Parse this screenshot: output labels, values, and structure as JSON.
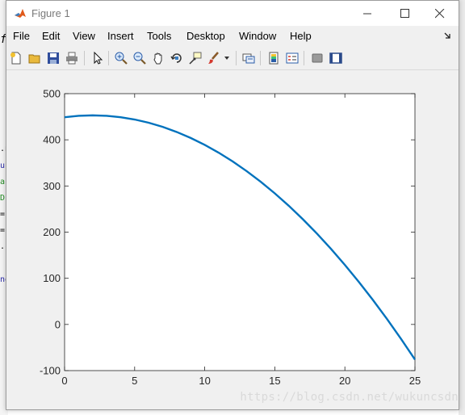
{
  "window": {
    "title": "Figure 1",
    "controls": {
      "minimize": "—",
      "maximize": "☐",
      "close": "✕"
    }
  },
  "menu": {
    "items": [
      "File",
      "Edit",
      "View",
      "Insert",
      "Tools",
      "Desktop",
      "Window",
      "Help"
    ]
  },
  "toolbar": {
    "buttons": [
      "new-figure-icon",
      "open-file-icon",
      "save-icon",
      "print-icon",
      "select-arrow-icon",
      "zoom-in-icon",
      "zoom-out-icon",
      "pan-hand-icon",
      "rotate-3d-icon",
      "data-cursor-icon",
      "brush-icon",
      "link-plot-icon",
      "colorbar-icon",
      "legend-icon",
      "hide-plot-tools-icon",
      "show-plot-tools-icon"
    ]
  },
  "background_fragments": [
    "f",
    ".n",
    "ur",
    "a",
    "D",
    "=",
    "=",
    ".c",
    "nd"
  ],
  "chart_data": {
    "type": "line",
    "xlim": [
      0,
      25
    ],
    "ylim": [
      -100,
      500
    ],
    "x_ticks": [
      "0",
      "5",
      "10",
      "15",
      "20",
      "25"
    ],
    "y_ticks": [
      "-100",
      "0",
      "100",
      "200",
      "300",
      "400",
      "500"
    ],
    "series": [
      {
        "color": "#0072bd",
        "x": [
          0,
          1,
          2,
          3,
          4,
          5,
          6,
          7,
          8,
          9,
          10,
          11,
          12,
          13,
          14,
          15,
          16,
          17,
          18,
          19,
          20,
          21,
          22,
          23,
          24,
          25
        ],
        "y": [
          449,
          452,
          453,
          452,
          449,
          444,
          437,
          428,
          417,
          404,
          389,
          372,
          353,
          332,
          309,
          284,
          257,
          228,
          197,
          164,
          129,
          92,
          53,
          12,
          -31,
          -76
        ]
      }
    ],
    "grid": false,
    "legend": "none"
  },
  "watermark": "https://blog.csdn.net/wukuncsdn"
}
